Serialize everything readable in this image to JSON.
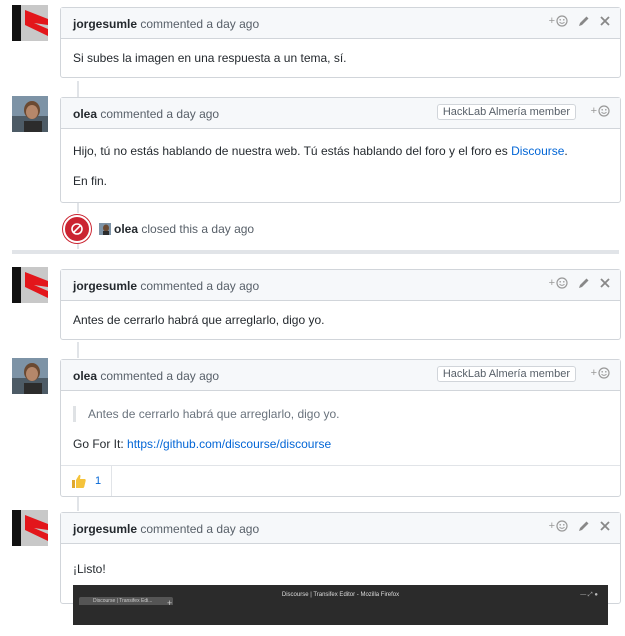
{
  "comments": [
    {
      "author": "jorgesumle",
      "meta": "commented a day ago",
      "body": [
        "Si subes la imagen en una respuesta a un tema, sí."
      ]
    },
    {
      "author": "olea",
      "meta": "commented a day ago",
      "badge": "HackLab Almería member",
      "body_p1_text": "Hijo, tú no estás hablando de nuestra web. Tú estás hablando del foro y el foro es ",
      "body_p1_link": "Discourse",
      "body_p1_end": ".",
      "body_p2": "En fin."
    },
    {
      "author": "jorgesumle",
      "meta": "commented a day ago",
      "body": [
        "Antes de cerrarlo habrá que arreglarlo, digo yo."
      ]
    },
    {
      "author": "olea",
      "meta": "commented a day ago",
      "badge": "HackLab Almería member",
      "quote": "Antes de cerrarlo habrá que arreglarlo, digo yo.",
      "line_text": "Go For It: ",
      "line_link": "https://github.com/discourse/discourse",
      "reaction_count": "1"
    },
    {
      "author": "jorgesumle",
      "meta": "commented a day ago",
      "body": [
        "¡Listo!"
      ],
      "screenshot_title": "Discourse | Transifex Editor - Mozilla Firefox",
      "screenshot_tab": "Discourse | Transifex Edi...",
      "screenshot_plus": "+"
    }
  ],
  "event": {
    "actor": "olea",
    "action": "closed this a day ago"
  },
  "actions": {
    "add_reaction": "+",
    "edit_icon": "pencil-icon",
    "delete_icon": "close-icon"
  },
  "colors": {
    "link": "#0366d6",
    "closed": "#cb2431",
    "header_bg": "#f6f8fa"
  }
}
